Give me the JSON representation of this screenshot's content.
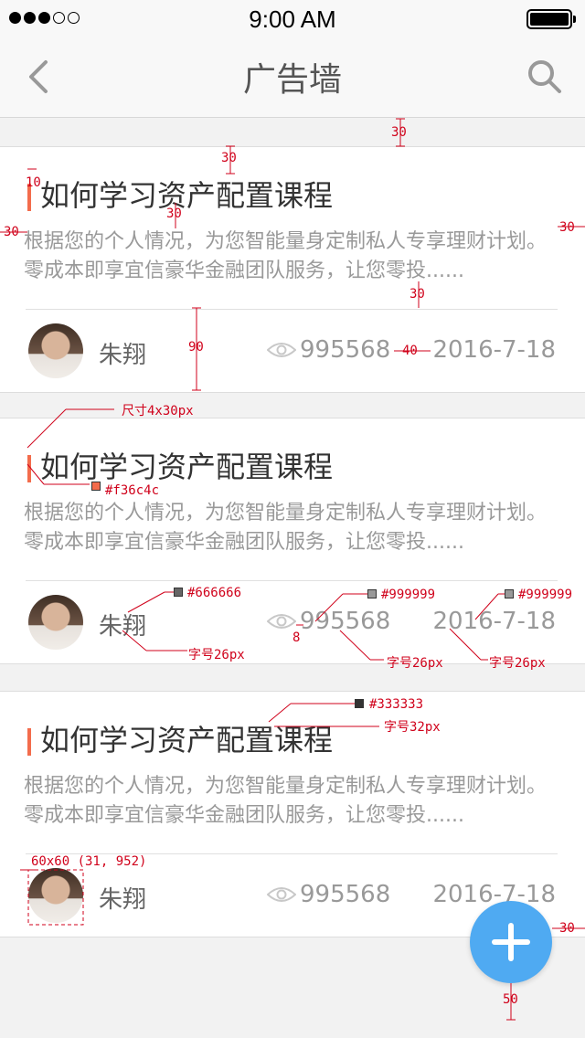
{
  "status_bar": {
    "time": "9:00 AM",
    "signal_dots_full": 3,
    "signal_dots_total": 5
  },
  "nav": {
    "title": "广告墙",
    "back_icon": "chevron-left-icon",
    "search_icon": "search-icon"
  },
  "cards": [
    {
      "title": "如何学习资产配置课程",
      "description": "根据您的个人情况，为您智能量身定制私人专享理财计划。零成本即享宜信豪华金融团队服务，让您零投......",
      "author": "朱翔",
      "views": "995568",
      "date": "2016-7-18"
    },
    {
      "title": "如何学习资产配置课程",
      "description": "根据您的个人情况，为您智能量身定制私人专享理财计划。零成本即享宜信豪华金融团队服务，让您零投......",
      "author": "朱翔",
      "views": "995568",
      "date": "2016-7-18"
    },
    {
      "title": "如何学习资产配置课程",
      "description": "根据您的个人情况，为您智能量身定制私人专享理财计划。零成本即享宜信豪华金融团队服务，让您零投......",
      "author": "朱翔",
      "views": "995568",
      "date": "2016-7-18"
    }
  ],
  "fab": {
    "icon": "plus-icon"
  },
  "colors": {
    "accent": "#f36c4c",
    "title_text": "#333333",
    "author_text": "#666666",
    "meta_text": "#999999",
    "fab": "#4faaf2"
  },
  "annotations": {
    "spacing_30": "30",
    "spacing_10": "10",
    "spacing_90": "90",
    "spacing_40": "40",
    "spacing_8": "8",
    "spacing_50": "50",
    "bar_size": "尺寸4x30px",
    "accent_color": "#f36c4c",
    "author_color": "#666666",
    "views_color": "#999999",
    "date_color": "#999999",
    "title_color": "#333333",
    "font_26": "字号26px",
    "font_32": "字号32px",
    "avatar_spec": "60x60 (31, 952)"
  }
}
